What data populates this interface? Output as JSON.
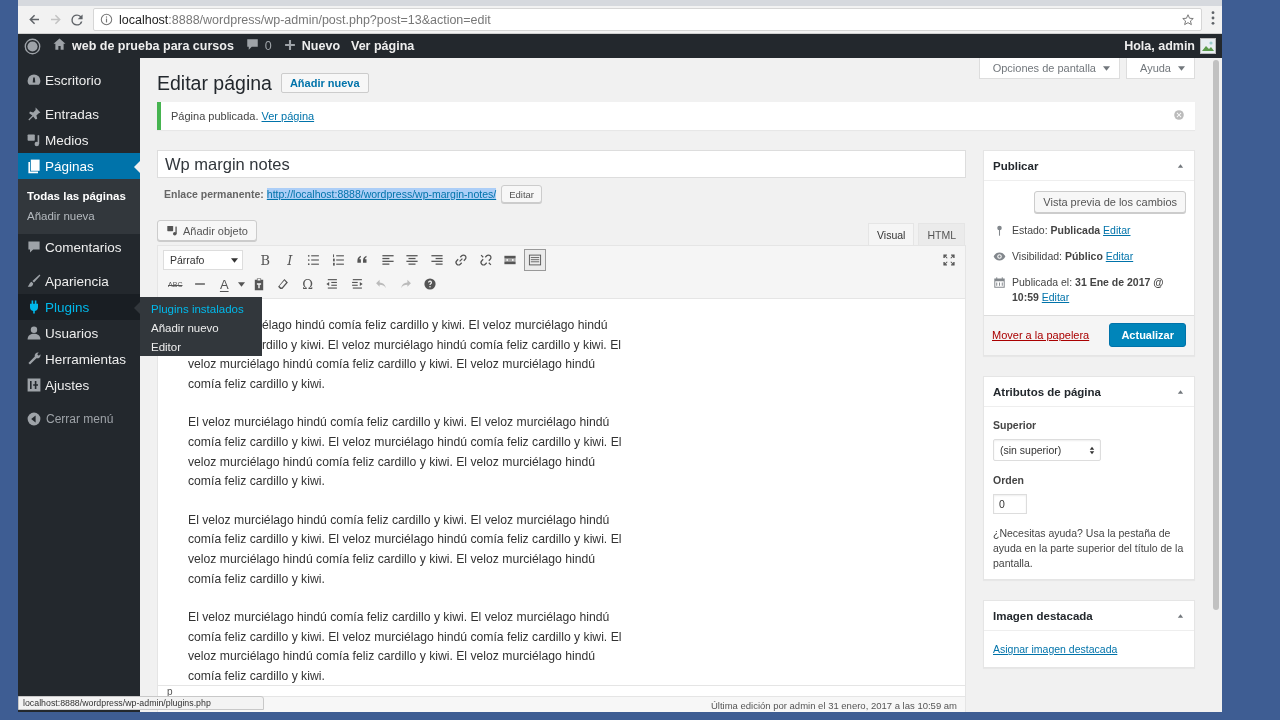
{
  "browser": {
    "url_host": "localhost",
    "url_path": ":8888/wordpress/wp-admin/post.php?post=13&action=edit",
    "forward_enabled": false,
    "status_link": "localhost:8888/wordpress/wp-admin/plugins.php"
  },
  "admin_bar": {
    "site_name": "web de prueba para cursos",
    "comment_count": "0",
    "new_label": "Nuevo",
    "view_label": "Ver página",
    "greeting": "Hola, admin"
  },
  "menu": {
    "groups": [
      [
        {
          "label": "Escritorio",
          "selected": false,
          "hovered": false
        }
      ],
      [
        {
          "label": "Entradas",
          "selected": false,
          "hovered": false
        },
        {
          "label": "Medios",
          "selected": false,
          "hovered": false
        },
        {
          "label": "Páginas",
          "selected": true,
          "hovered": false,
          "children": [
            {
              "label": "Todas las páginas",
              "selected": true
            },
            {
              "label": "Añadir nueva",
              "selected": false
            }
          ]
        },
        {
          "label": "Comentarios",
          "selected": false,
          "hovered": false
        }
      ],
      [
        {
          "label": "Apariencia",
          "selected": false,
          "hovered": false
        },
        {
          "label": "Plugins",
          "selected": false,
          "hovered": true,
          "flyout": [
            {
              "label": "Plugins instalados",
              "hovered": true
            },
            {
              "label": "Añadir nuevo",
              "hovered": false
            },
            {
              "label": "Editor",
              "hovered": false
            }
          ]
        },
        {
          "label": "Usuarios",
          "selected": false,
          "hovered": false
        },
        {
          "label": "Herramientas",
          "selected": false,
          "hovered": false
        },
        {
          "label": "Ajustes",
          "selected": false,
          "hovered": false
        }
      ]
    ],
    "collapse_label": "Cerrar menú"
  },
  "screen_tabs": [
    "Opciones de pantalla",
    "Ayuda"
  ],
  "heading": "Editar página",
  "add_new": "Añadir nueva",
  "notice": {
    "text": "Página publicada.",
    "link": "Ver página"
  },
  "post_title": "Wp margin notes",
  "permalink": {
    "label": "Enlace permanente:",
    "url": "http://localhost:8888/wordpress/wp-margin-notes/",
    "highlighted": true,
    "edit": "Editar"
  },
  "editor": {
    "add_media": "Añadir objeto",
    "tabs": [
      {
        "label": "Visual",
        "selected": true
      },
      {
        "label": "HTML",
        "selected": false
      }
    ],
    "format": "Párrafo",
    "glyphs": {
      "bold": "B",
      "italic": "I",
      "strike": "ABC",
      "tint": "A",
      "special": "Ω"
    },
    "toolbar_toggle_pressed": true,
    "undo_enabled": false,
    "redo_enabled": false,
    "paragraphs": [
      {
        "kind": "partly_covered",
        "covered_lines": [
          "élago hindú comía feliz cardillo y kiwi. El veloz murciélago hindú",
          "rdillo y kiwi. El veloz murciélago hindú comía feliz cardillo y kiwi. El"
        ],
        "lines": [
          "veloz murciélago hindú comía feliz cardillo y kiwi. El veloz murciélago hindú",
          "comía feliz cardillo y kiwi."
        ]
      },
      "El veloz murciélago hindú comía feliz cardillo y kiwi. El veloz murciélago hindú comía feliz cardillo y kiwi. El veloz murciélago hindú comía feliz cardillo y kiwi. El veloz murciélago hindú comía feliz cardillo y kiwi. El veloz murciélago hindú comía feliz cardillo y kiwi.",
      "El veloz murciélago hindú comía feliz cardillo y kiwi. El veloz murciélago hindú comía feliz cardillo y kiwi. El veloz murciélago hindú comía feliz cardillo y kiwi. El veloz murciélago hindú comía feliz cardillo y kiwi. El veloz murciélago hindú comía feliz cardillo y kiwi.",
      "El veloz murciélago hindú comía feliz cardillo y kiwi. El veloz murciélago hindú comía feliz cardillo y kiwi. El veloz murciélago hindú comía feliz cardillo y kiwi. El veloz murciélago hindú comía feliz cardillo y kiwi. El veloz murciélago hindú comía feliz cardillo y kiwi."
    ],
    "path": "p",
    "last_edit": "Última edición por admin el 31 enero, 2017 a las 10:59 am"
  },
  "publish": {
    "title": "Publicar",
    "expanded": true,
    "preview": "Vista previa de los cambios",
    "rows": [
      {
        "text": "Estado: **Publicada**",
        "link": "Editar"
      },
      {
        "text": "Visibilidad: **Público**",
        "link": "Editar"
      },
      {
        "text": "Publicada el: **31 Ene de 2017 @ 10:59**",
        "link": "Editar"
      }
    ],
    "trash": "Mover a la papelera",
    "update": "Actualizar"
  },
  "attributes": {
    "title": "Atributos de página",
    "expanded": true,
    "parent_label": "Superior",
    "parent_value": "(sin superior)",
    "order_label": "Orden",
    "order_value": "0",
    "help": "¿Necesitas ayuda? Usa la pestaña de ayuda en la parte superior del título de la pantalla."
  },
  "featured": {
    "title": "Imagen destacada",
    "expanded": true,
    "link": "Asignar imagen destacada"
  }
}
